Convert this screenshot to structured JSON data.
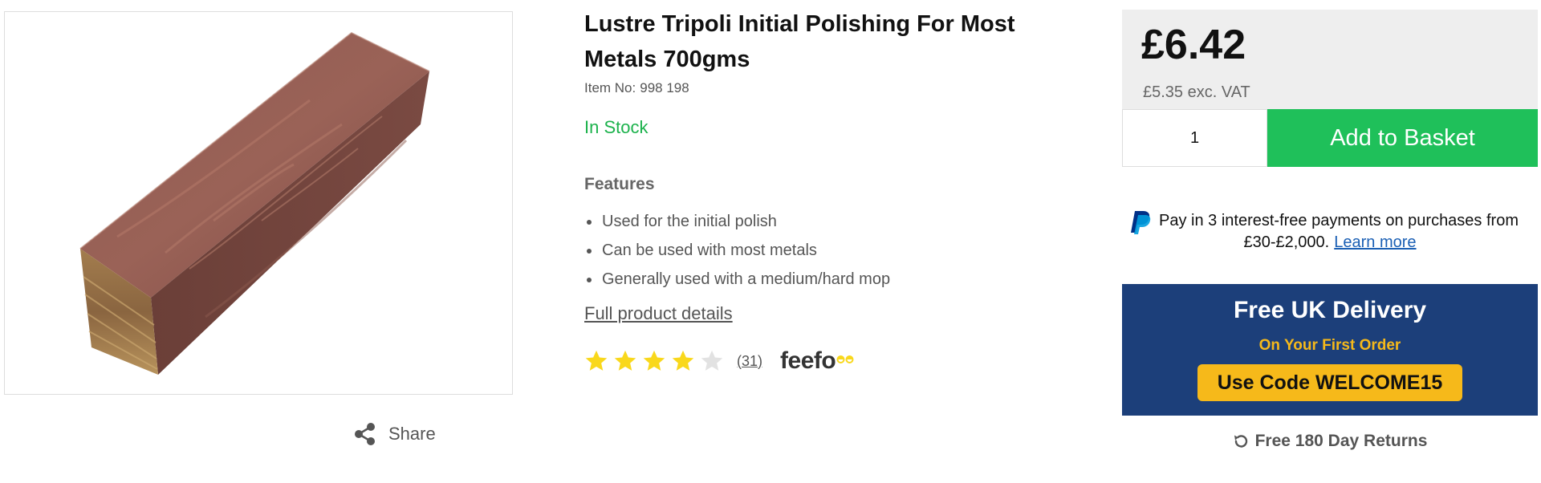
{
  "product": {
    "title": "Lustre Tripoli Initial Polishing For Most Metals 700gms",
    "item_no_label": "Item No:",
    "item_no": "998 198",
    "stock_status": "In Stock",
    "image_alt": "Lustre Tripoli polishing compound bar"
  },
  "share": {
    "label": "Share",
    "icon": "share-icon"
  },
  "features": {
    "heading": "Features",
    "items": [
      "Used for the initial polish",
      "Can be used with most metals",
      "Generally used with a medium/hard mop"
    ],
    "full_details_link": "Full product details"
  },
  "rating": {
    "stars": 4,
    "max_stars": 5,
    "review_count": "(31)",
    "provider": "feefo",
    "filled_color": "#f9d81c",
    "empty_color": "#e2e2e2"
  },
  "pricing": {
    "price": "£6.42",
    "price_ex_vat": "£5.35 exc. VAT",
    "quantity": "1",
    "add_button": "Add to Basket"
  },
  "paypal": {
    "line1": "Pay in 3 interest-free payments on purchases from",
    "line2": "£30-£2,000.",
    "learn_more": "Learn more"
  },
  "promo": {
    "title": "Free UK Delivery",
    "subtitle": "On Your First Order",
    "code_text": "Use Code WELCOME15"
  },
  "returns": {
    "label": "Free 180 Day Returns",
    "icon": "returns-icon"
  },
  "colors": {
    "accent_green": "#1fc05a",
    "stock_green": "#1cb24c",
    "promo_navy": "#1c3f7a",
    "promo_yellow": "#f6b91a",
    "link_blue": "#1a5fb4"
  }
}
